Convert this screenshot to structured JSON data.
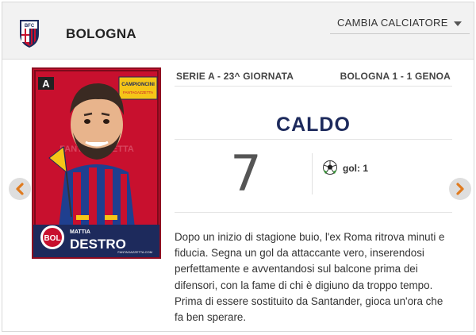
{
  "header": {
    "team_name": "BOLOGNA",
    "crest_icon": "bologna-crest-icon",
    "change_player_label": "CAMBIA CALCIATORE"
  },
  "navigation": {
    "prev_icon": "chevron-left-icon",
    "next_icon": "chevron-right-icon",
    "arrow_color": "#e07b1f"
  },
  "card": {
    "logo_letter": "A",
    "badge_text": "CAMPIONCINI",
    "badge_subtext": "FANTAGAZZETTA",
    "watermark": "FANTAGAZZETTA",
    "club_abbr": "BOL",
    "player_first_name": "MATTIA",
    "player_last_name": "DESTRO",
    "footer_text": "FANTAGAZZETTA.COM",
    "colors": {
      "red": "#c8102e",
      "blue": "#1f3f8f",
      "navy": "#1d2a5c"
    }
  },
  "match_info": {
    "round": "SERIE A - 23^ GIORNATA",
    "score": "BOLOGNA 1 - 1 GENOA"
  },
  "rating": {
    "verdict": "CALDO",
    "grade": "7",
    "stat_icon": "soccer-ball-icon",
    "stat": "gol: 1"
  },
  "description": "Dopo un inizio di stagione buio, l'ex Roma ritrova minuti e fiducia. Segna un gol da attaccante vero, inserendosi perfettamente e avventandosi sul balcone prima dei difensori, con la fame di chi è digiuno da troppo tempo. Prima di essere sostituito da Santander, gioca un'ora che fa ben sperare."
}
